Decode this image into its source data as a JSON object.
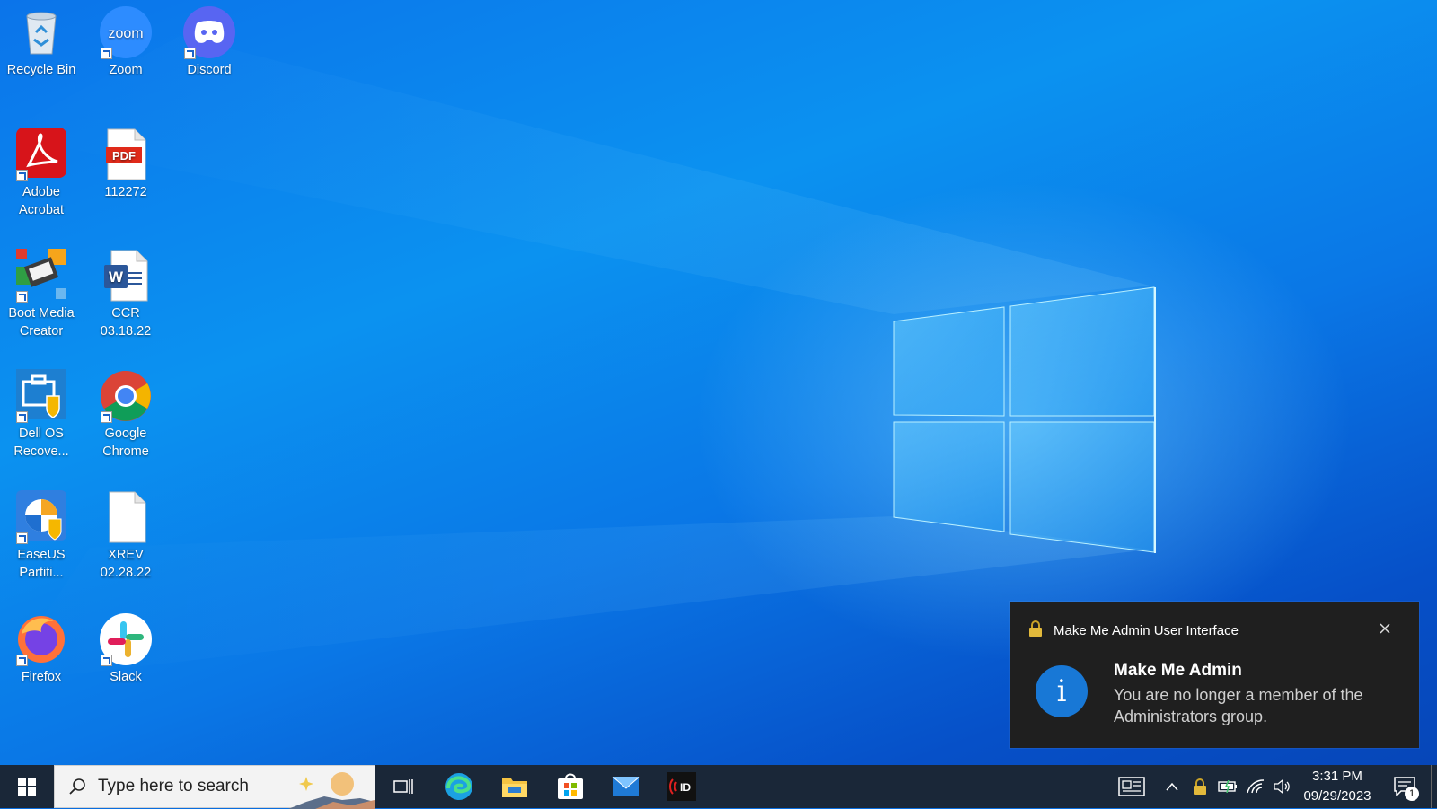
{
  "desktop": {
    "icons": [
      {
        "label": "Recycle Bin",
        "icon": "recycle-bin-icon"
      },
      {
        "label": "Zoom",
        "icon": "zoom-icon"
      },
      {
        "label": "Discord",
        "icon": "discord-icon"
      },
      {
        "label": "Adobe Acrobat",
        "icon": "adobe-acrobat-icon"
      },
      {
        "label": "112272",
        "icon": "pdf-file-icon"
      },
      {
        "label": "Boot Media Creator",
        "icon": "boot-media-creator-icon"
      },
      {
        "label": "CCR 03.18.22",
        "icon": "word-document-icon"
      },
      {
        "label": "Dell OS Recove...",
        "icon": "dell-os-recovery-icon"
      },
      {
        "label": "Google Chrome",
        "icon": "google-chrome-icon"
      },
      {
        "label": "EaseUS Partiti...",
        "icon": "easeus-partition-icon"
      },
      {
        "label": "XREV 02.28.22",
        "icon": "text-file-icon"
      },
      {
        "label": "Firefox",
        "icon": "firefox-icon"
      },
      {
        "label": "Slack",
        "icon": "slack-icon"
      }
    ]
  },
  "toast": {
    "app_name": "Make Me Admin User Interface",
    "title": "Make Me Admin",
    "body": "You are no longer a member of the Administrators group.",
    "app_icon": "lock-icon",
    "info_icon": "info-icon",
    "info_glyph": "i"
  },
  "taskbar": {
    "search_placeholder": "Type here to search",
    "pinned": [
      "task-view-icon",
      "edge-icon",
      "file-explorer-icon",
      "microsoft-store-icon",
      "mail-icon",
      "id-app-icon"
    ],
    "tray": [
      "news-icon",
      "chevron-up-icon",
      "lock-icon",
      "battery-icon",
      "wifi-icon",
      "volume-icon"
    ],
    "time": "3:31 PM",
    "date": "09/29/2023",
    "notification_count": "1"
  },
  "colors": {
    "desktop_blue": "#0a6ee0",
    "taskbar": "#1a2738",
    "toast_bg": "#1f1f1f",
    "info_blue": "#1878d6"
  }
}
